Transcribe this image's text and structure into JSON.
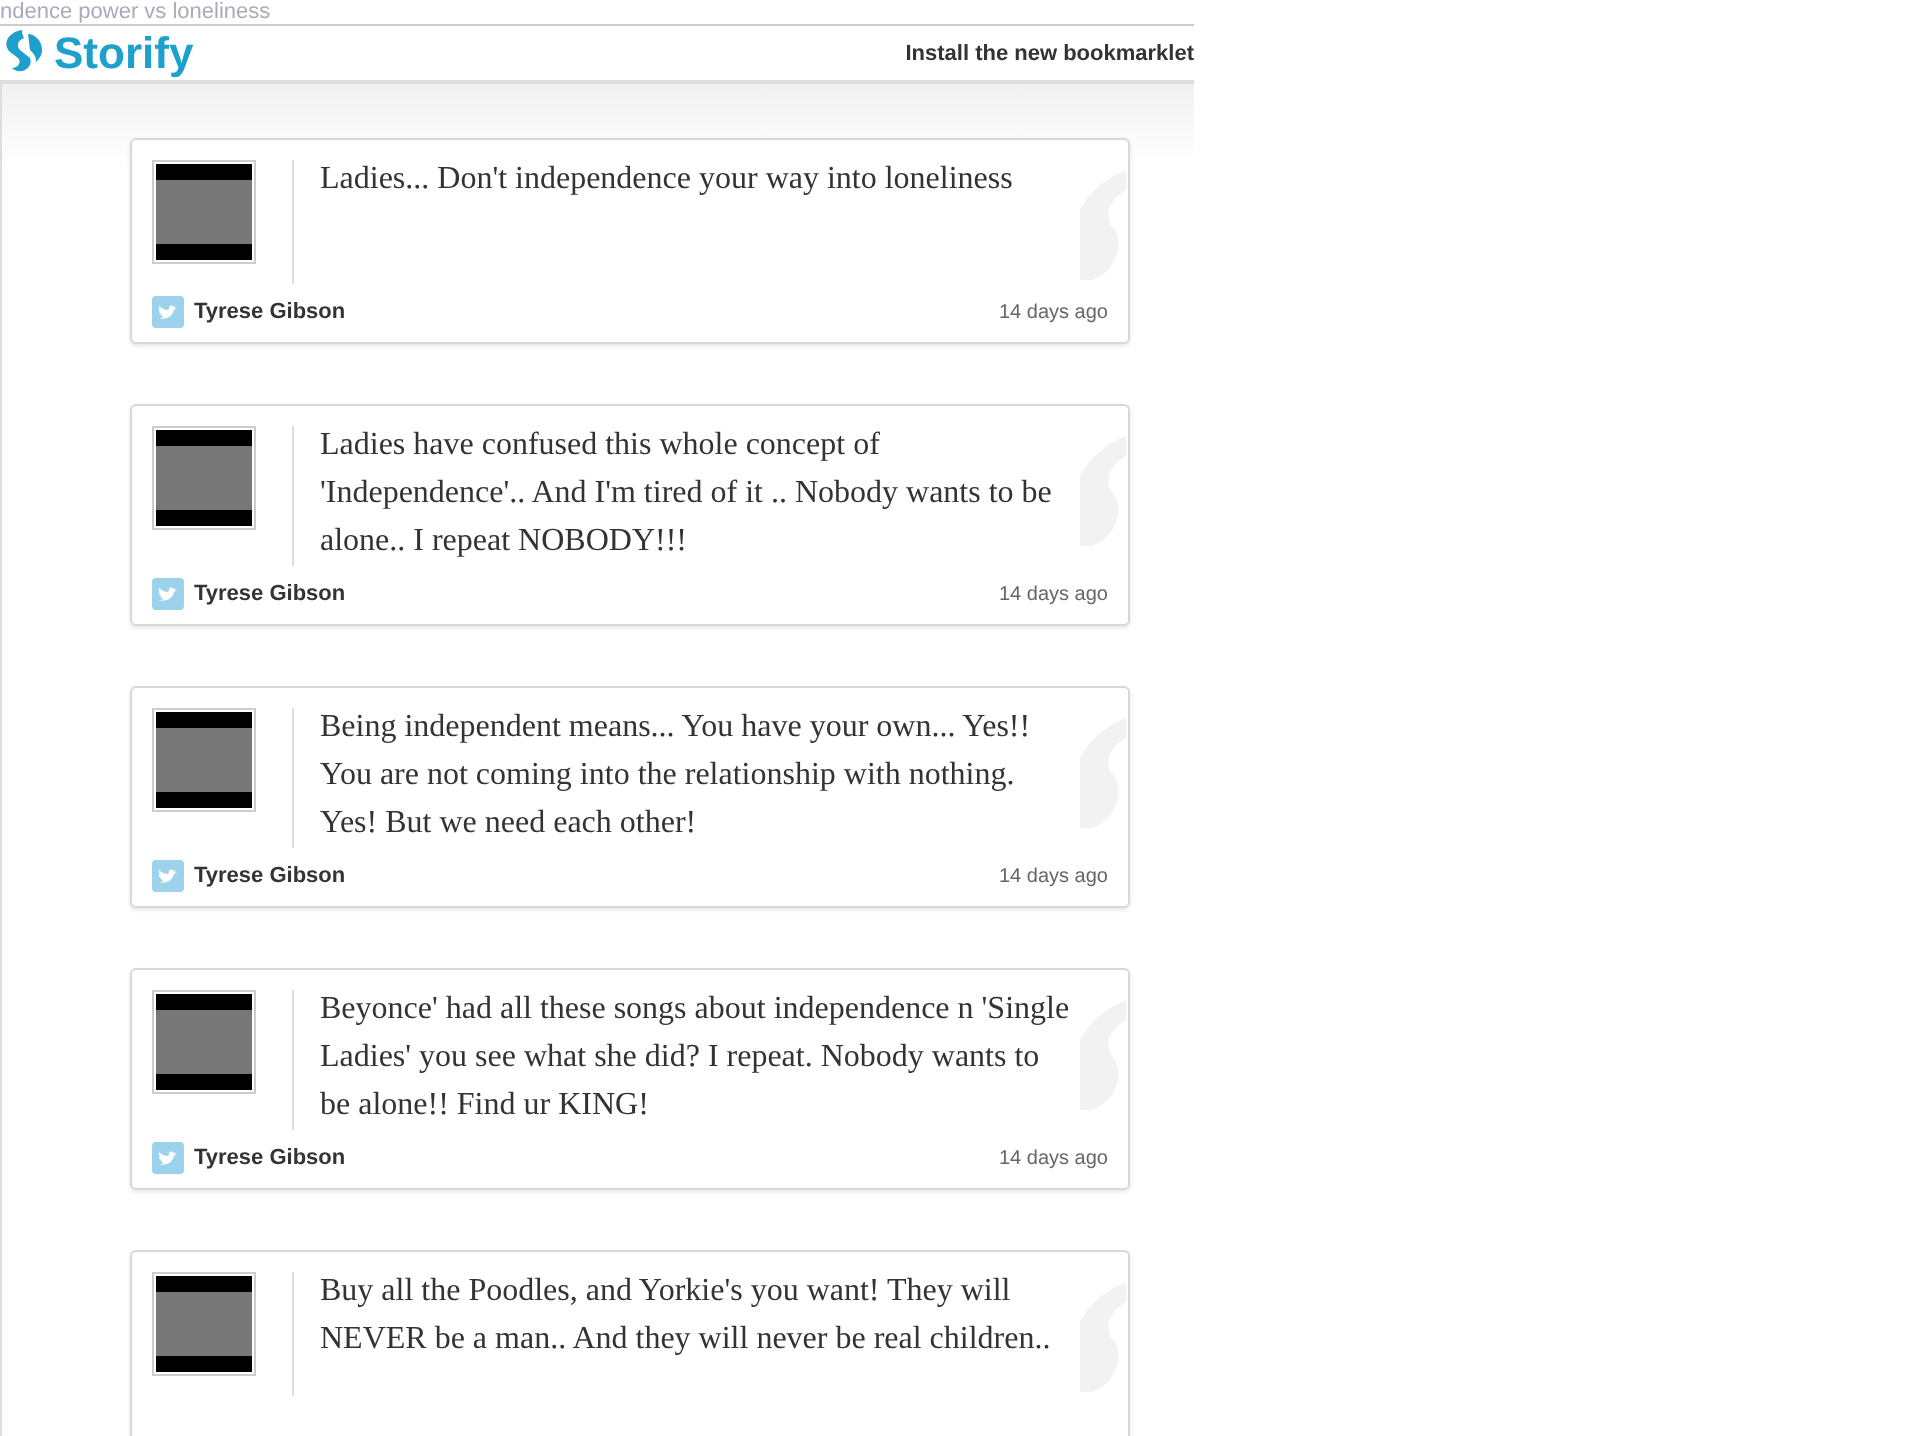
{
  "page_title": "ndence power vs loneliness",
  "header": {
    "logo": "Storify",
    "link": "Install the new bookmarklet"
  },
  "tweets": [
    {
      "text": "Ladies... Don't independence your way into loneliness",
      "author": "Tyrese Gibson",
      "time": "14 days ago"
    },
    {
      "text": "Ladies have confused this whole concept of 'Independence'.. And I'm tired of it .. Nobody wants to be alone.. I repeat NOBODY!!!",
      "author": "Tyrese Gibson",
      "time": "14 days ago"
    },
    {
      "text": "Being independent means... You have your own... Yes!! You are not coming into the relationship with nothing. Yes! But we need each other!",
      "author": "Tyrese Gibson",
      "time": "14 days ago"
    },
    {
      "text": "Beyonce' had all these songs about independence n 'Single Ladies' you see what she did? I repeat. Nobody wants to be alone!! Find ur KING!",
      "author": "Tyrese Gibson",
      "time": "14 days ago"
    },
    {
      "text": "Buy all the Poodles, and Yorkie's you want! They will NEVER be a man.. And they will never be real children.."
    }
  ]
}
